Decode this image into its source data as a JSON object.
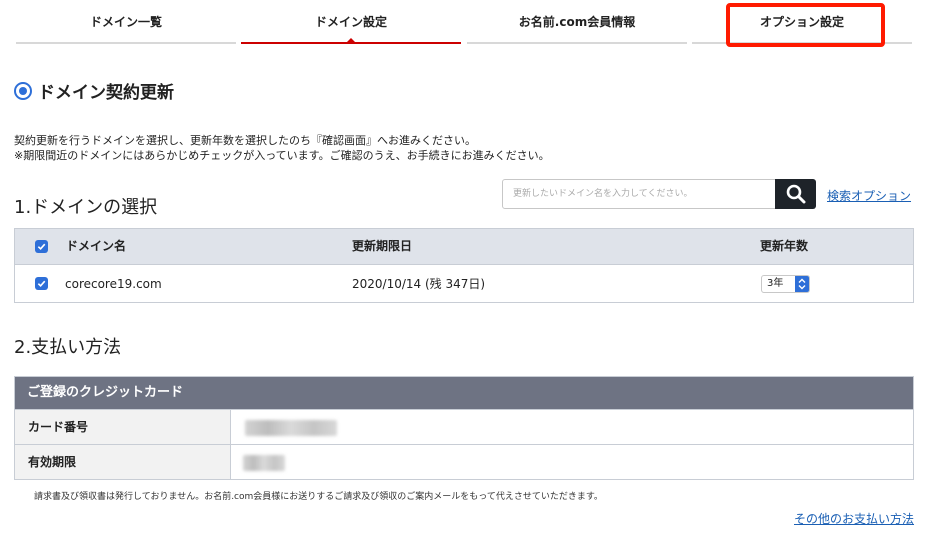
{
  "tabs": [
    {
      "label": "ドメイン一覧",
      "active": false
    },
    {
      "label": "ドメイン設定",
      "active": true
    },
    {
      "label": "お名前.com会員情報",
      "active": false
    },
    {
      "label": "オプション設定",
      "active": false,
      "highlighted": true
    }
  ],
  "section": {
    "title": "ドメイン契約更新"
  },
  "description": {
    "line1": "契約更新を行うドメインを選択し、更新年数を選択したのち『確認画面』へお進みください。",
    "line2": "※期限間近のドメインにはあらかじめチェックが入っています。ご確認のうえ、お手続きにお進みください。"
  },
  "step1": {
    "title": "1.ドメインの選択"
  },
  "search": {
    "placeholder": "更新したいドメイン名を入力してください。",
    "option_link": "検索オプション"
  },
  "domain_table": {
    "headers": {
      "name": "ドメイン名",
      "expiry": "更新期限日",
      "years": "更新年数"
    },
    "header_checked": true,
    "rows": [
      {
        "checked": true,
        "domain": "corecore19.com",
        "expiry": "2020/10/14 (残 347日)",
        "years": "3年"
      }
    ]
  },
  "step2": {
    "title": "2.支払い方法"
  },
  "payment": {
    "header": "ご登録のクレジットカード",
    "card_number_label": "カード番号",
    "expiry_label": "有効期限"
  },
  "note": "請求書及び領収書は発行しておりません。お名前.com会員様にお送りするご請求及び領収のご案内メールをもって代えさせていただきます。",
  "other_payment_link": "その他のお支払い方法",
  "colors": {
    "accent_red": "#cc0000",
    "highlight": "#ff1a00",
    "blue": "#2e6fd8",
    "link": "#1a5fb4"
  }
}
